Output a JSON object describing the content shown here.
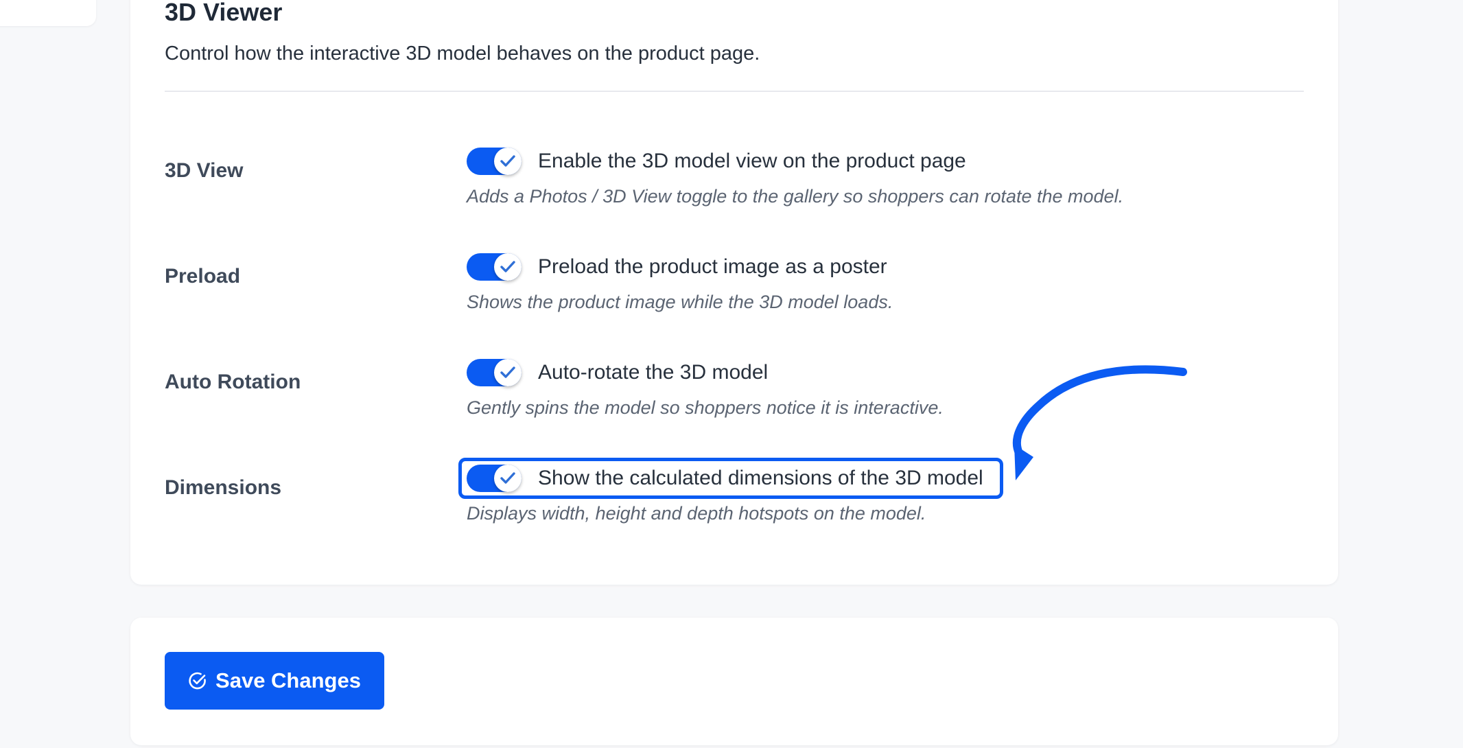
{
  "section": {
    "title": "3D Viewer",
    "description": "Control how the interactive 3D model behaves on the product page."
  },
  "settings": [
    {
      "label": "3D View",
      "option": "Enable the 3D model view on the product page",
      "help": "Adds a Photos / 3D View toggle to the gallery so shoppers can rotate the model.",
      "enabled": true
    },
    {
      "label": "Preload",
      "option": "Preload the product image as a poster",
      "help": "Shows the product image while the 3D model loads.",
      "enabled": true
    },
    {
      "label": "Auto Rotation",
      "option": "Auto-rotate the 3D model",
      "help": "Gently spins the model so shoppers notice it is interactive.",
      "enabled": true
    },
    {
      "label": "Dimensions",
      "option": "Show the calculated dimensions of the 3D model",
      "help": "Displays width, height and depth hotspots on the model.",
      "enabled": true
    }
  ],
  "actions": {
    "save_label": "Save Changes",
    "save_icon": "check-circle-icon"
  },
  "colors": {
    "accent": "#0b5bf2",
    "checkmark": "#2f6fd6",
    "page_bg": "#f7f8fa",
    "card_bg": "#ffffff"
  },
  "icons": {
    "toggle_check": "checkmark-icon",
    "annotation": "curved-arrow-icon"
  }
}
